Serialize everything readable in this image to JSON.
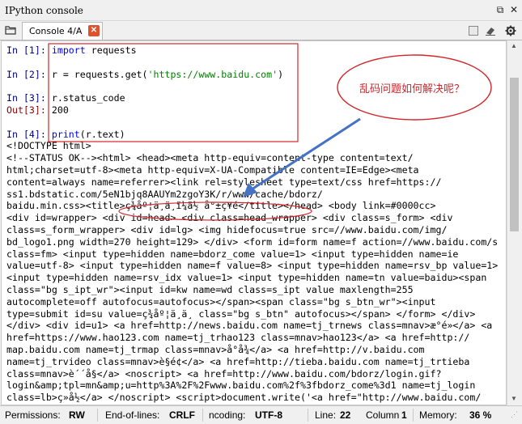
{
  "window": {
    "title": "IPython console"
  },
  "tabs": [
    {
      "label": "Console 4/A"
    }
  ],
  "console": {
    "cells": [
      {
        "in_prompt": "In [1]:",
        "code_kw": "import",
        "code_rest": " requests"
      },
      {
        "in_prompt": "In [2]:",
        "code_pre": "r = requests.get(",
        "code_str": "'https://www.baidu.com'",
        "code_post": ")"
      },
      {
        "in_prompt": "In [3]:",
        "code": "r.status_code",
        "out_prompt": "Out[3]:",
        "out_value": "200"
      },
      {
        "in_prompt": "In [4]:",
        "code_kw": "print",
        "code_rest": "(r.text)"
      }
    ],
    "output_lines": [
      "<!DOCTYPE html>",
      "<!--STATUS OK--><html> <head><meta http-equiv=content-type content=text/",
      "html;charset=utf-8><meta http-equiv=X-UA-Compatible content=IE=Edge><meta",
      "content=always name=referrer><link rel=stylesheet type=text/css href=https://",
      "ss1.bdstatic.com/5eN1bjq8AAUYm2zgoY3K/r/www/cache/bdorz/",
      "baidu.min.css><title>ç¾åº¦ä¸ä¸ï¼ä½ å°±ç¥é</title></head> <body link=#0000cc>",
      "<div id=wrapper> <div id=head> <div class=head_wrapper> <div class=s_form> <div",
      "class=s_form_wrapper> <div id=lg> <img hidefocus=true src=//www.baidu.com/img/",
      "bd_logo1.png width=270 height=129> </div> <form id=form name=f action=//www.baidu.com/s",
      "class=fm> <input type=hidden name=bdorz_come value=1> <input type=hidden name=ie",
      "value=utf-8> <input type=hidden name=f value=8> <input type=hidden name=rsv_bp value=1>",
      "<input type=hidden name=rsv_idx value=1> <input type=hidden name=tn value=baidu><span",
      "class=\"bg s_ipt_wr\"><input id=kw name=wd class=s_ipt value maxlength=255",
      "autocomplete=off autofocus=autofocus></span><span class=\"bg s_btn_wr\"><input",
      "type=submit id=su value=ç¾åº¦ä¸ä¸ class=\"bg s_btn\" autofocus></span> </form> </div>",
      "</div> <div id=u1> <a href=http://news.baidu.com name=tj_trnews class=mnav>æ°é»</a> <a",
      "href=https://www.hao123.com name=tj_trhao123 class=mnav>hao123</a> <a href=http://",
      "map.baidu.com name=tj_trmap class=mnav>å°å¾</a> <a href=http://v.baidu.com",
      "name=tj_trvideo class=mnav>è§é¢</a> <a href=http://tieba.baidu.com name=tj_trtieba",
      "class=mnav>è´´å§</a> <noscript> <a href=http://www.baidu.com/bdorz/login.gif?",
      "login&amp;tpl=mn&amp;u=http%3A%2F%2Fwww.baidu.com%2f%3fbdorz_come%3d1 name=tj_login",
      "class=lb>ç»å½</a> </noscript> <script>document.write('<a href=\"http://www.baidu.com/"
    ]
  },
  "annotation": {
    "callout_text": "乱码问题如何解决呢？",
    "color": "#d1262b",
    "arrow_color": "#4472c4"
  },
  "statusbar": {
    "permissions_label": "Permissions:",
    "permissions_value": "RW",
    "eol_label": "End-of-lines:",
    "eol_value": "CRLF",
    "encoding_label": "ncoding:",
    "encoding_value": "UTF-8",
    "line_label": "Line:",
    "line_value": "22",
    "column_label": "Column",
    "column_value": "1",
    "memory_label": "Memory:",
    "memory_value": "36 %"
  }
}
